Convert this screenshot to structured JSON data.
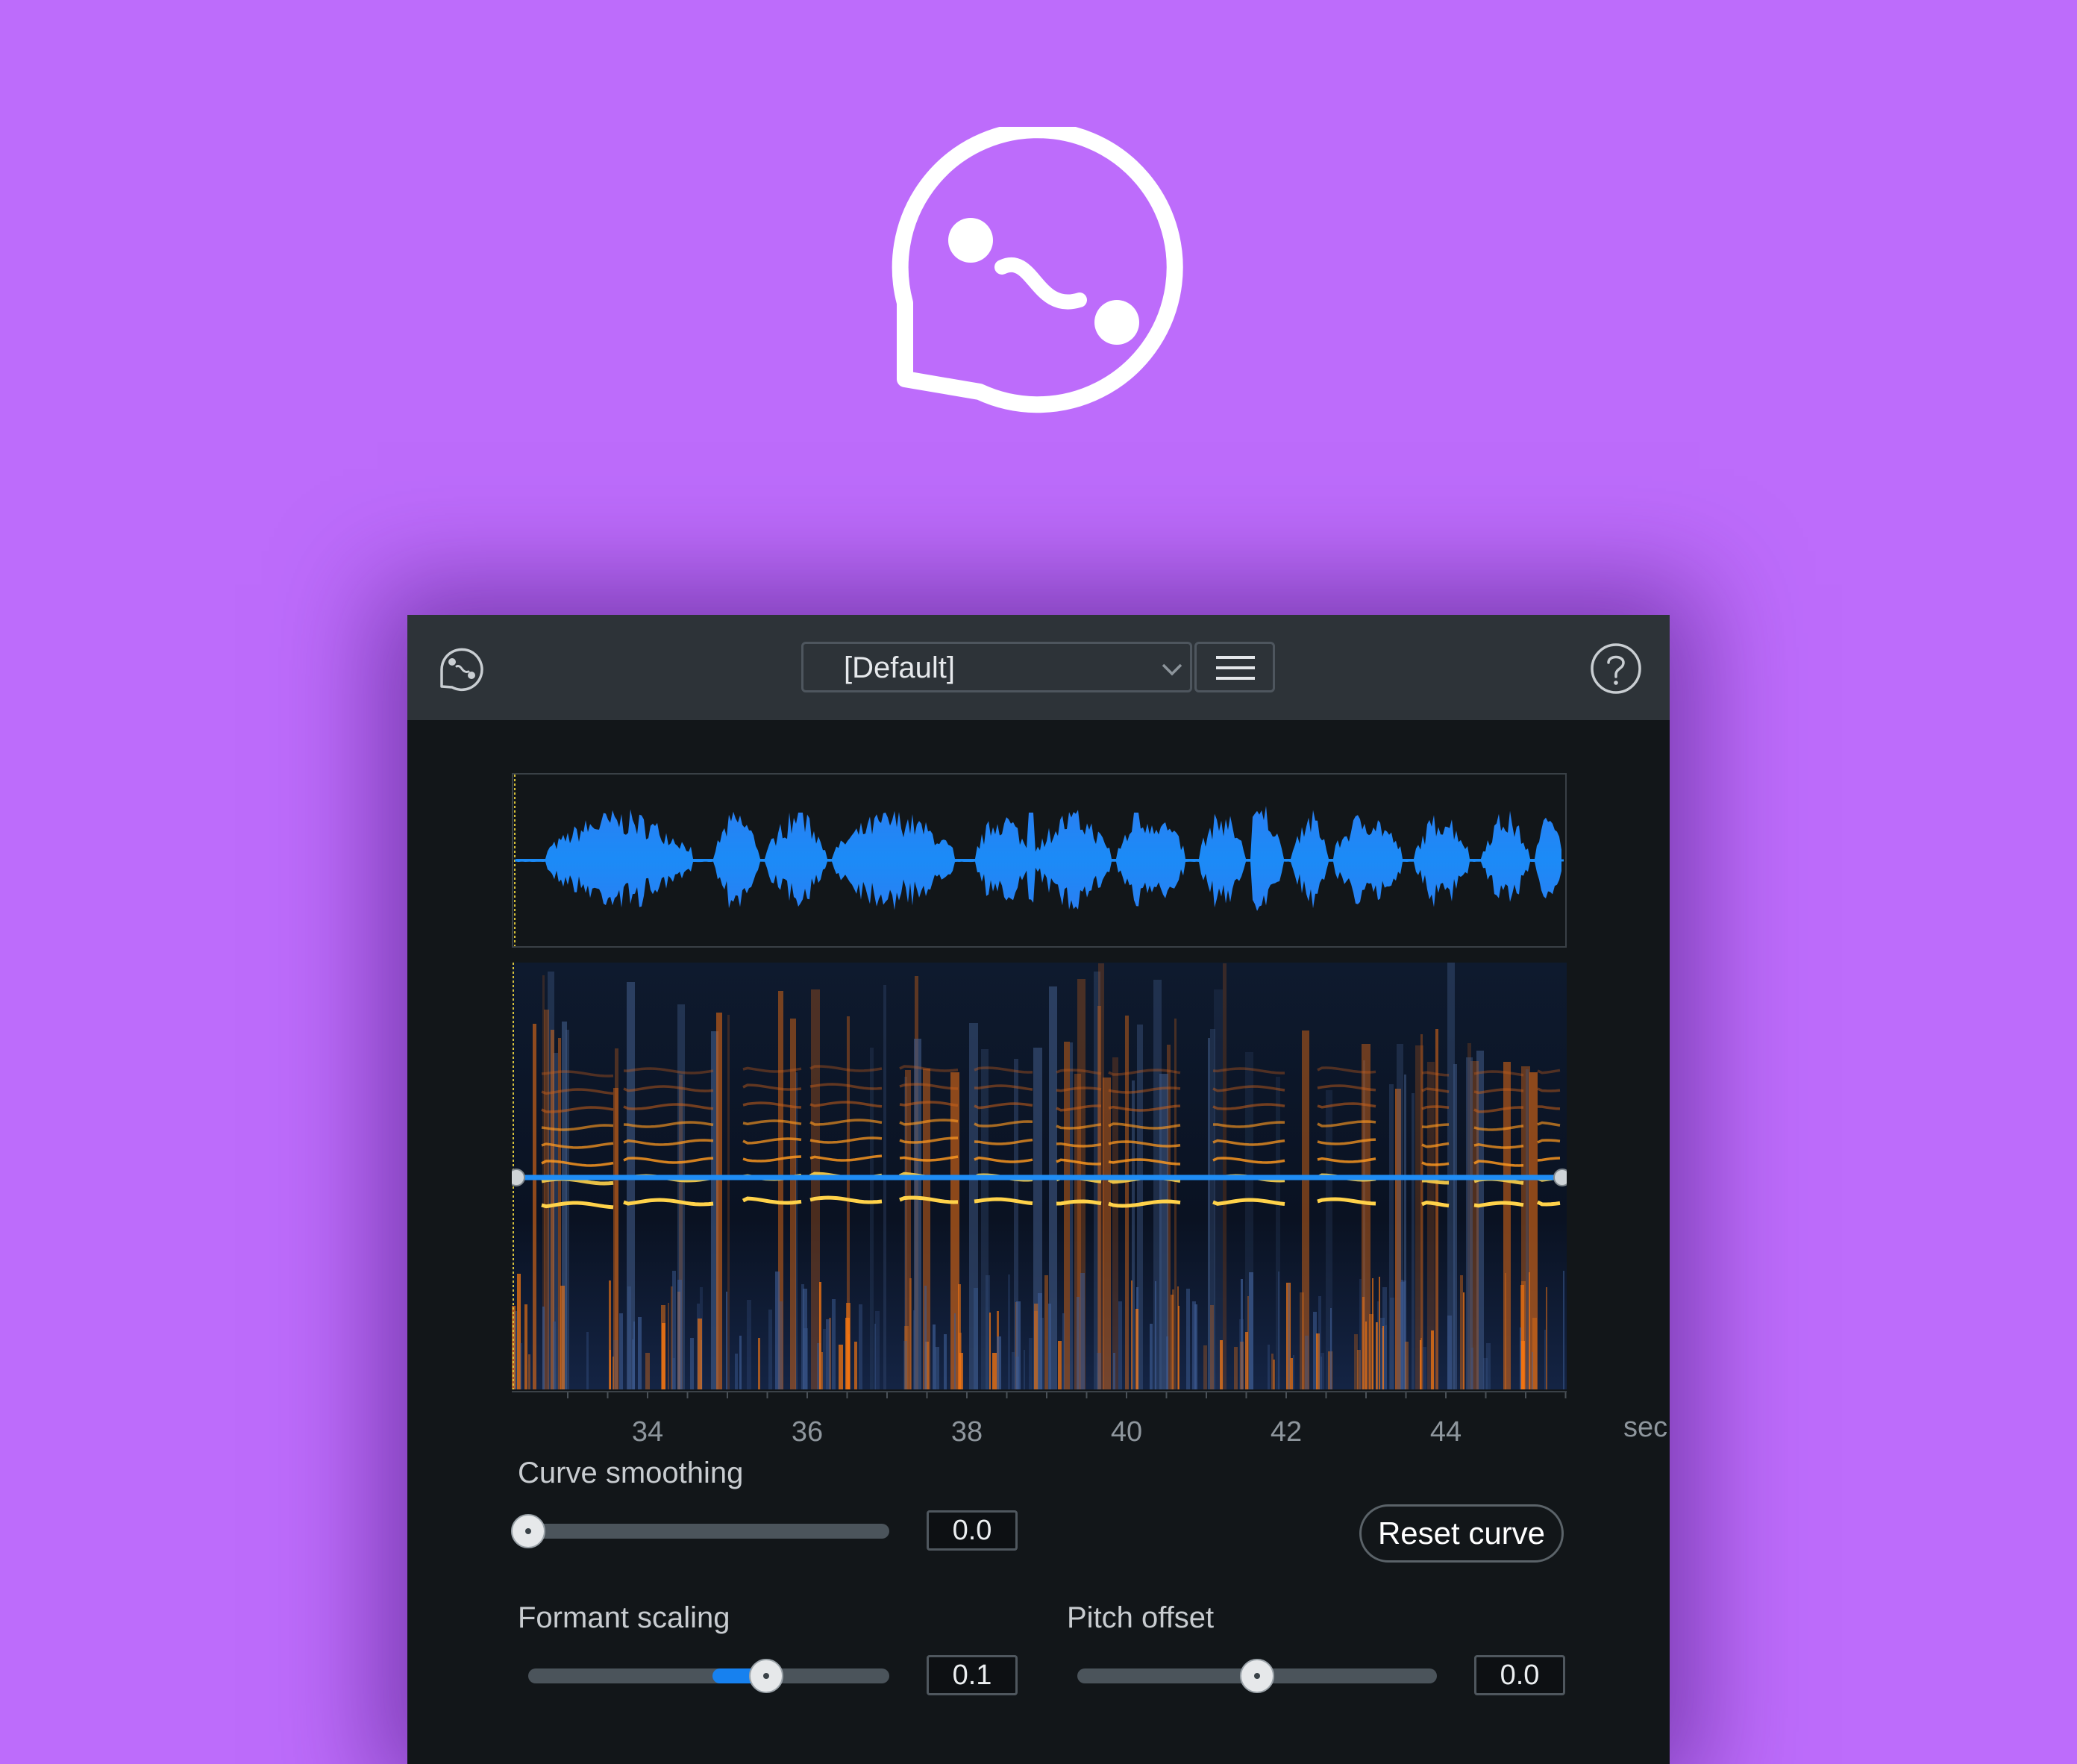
{
  "colors": {
    "background": "#bd6cfb",
    "panel": "#121619",
    "header": "#2d3338",
    "accent_blue": "#1781ef",
    "spectro_orange": "#ff8a1e"
  },
  "icons": {
    "hero": "dialogue-contour-logo-icon",
    "header_logo": "dialogue-contour-logo-icon",
    "preset_dropdown": "chevron-down-icon",
    "menu": "hamburger-menu-icon",
    "help": "question-circle-icon"
  },
  "header": {
    "preset_value": "[Default]"
  },
  "timeline": {
    "ticks": [
      "34",
      "36",
      "38",
      "40",
      "42",
      "44"
    ],
    "unit": "sec"
  },
  "controls": {
    "curve_smoothing": {
      "label": "Curve smoothing",
      "value": "0.0",
      "level": 0.0
    },
    "reset_button": "Reset curve",
    "formant_scaling": {
      "label": "Formant scaling",
      "value": "0.1",
      "level": 0.66
    },
    "pitch_offset": {
      "label": "Pitch offset",
      "value": "0.0",
      "level": 0.5
    }
  }
}
